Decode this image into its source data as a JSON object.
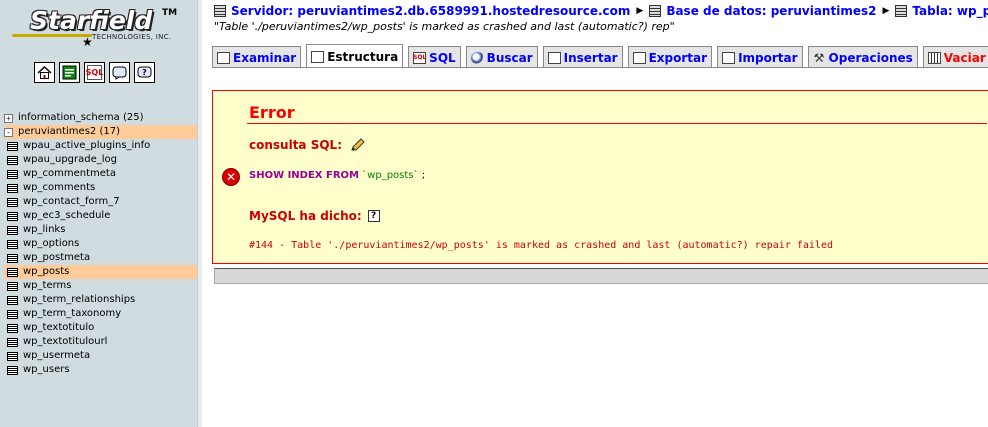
{
  "logo": {
    "brand": "Starfield",
    "tm": "TM",
    "sub": "TECHNOLOGIES, INC."
  },
  "nav_icons": [
    "home-icon",
    "sql-query-window-icon",
    "sql-icon",
    "docs-icon",
    "help-icon"
  ],
  "databases": [
    {
      "name": "information_schema (25)",
      "expander": "+",
      "active": false
    },
    {
      "name": "peruviantimes2 (17)",
      "expander": "-",
      "active": true
    }
  ],
  "tables": [
    "wpau_active_plugins_info",
    "wpau_upgrade_log",
    "wp_commentmeta",
    "wp_comments",
    "wp_contact_form_7",
    "wp_ec3_schedule",
    "wp_links",
    "wp_options",
    "wp_postmeta",
    "wp_posts",
    "wp_terms",
    "wp_term_relationships",
    "wp_term_taxonomy",
    "wp_textotitulo",
    "wp_textotitulourl",
    "wp_usermeta",
    "wp_users"
  ],
  "active_table": "wp_posts",
  "breadcrumb": {
    "server": "Servidor: peruviantimes2.db.6589991.hostedresource.com",
    "database": "Base de datos: peruviantimes2",
    "table": "Tabla: wp_posts"
  },
  "subtitle": "\"Table './peruviantimes2/wp_posts' is marked as crashed and last (automatic?) rep\"",
  "tabs": [
    {
      "label": "Examinar",
      "active": false,
      "danger": false
    },
    {
      "label": "Estructura",
      "active": true,
      "danger": false
    },
    {
      "label": "SQL",
      "active": false,
      "danger": false
    },
    {
      "label": "Buscar",
      "active": false,
      "danger": false
    },
    {
      "label": "Insertar",
      "active": false,
      "danger": false
    },
    {
      "label": "Exportar",
      "active": false,
      "danger": false
    },
    {
      "label": "Importar",
      "active": false,
      "danger": false
    },
    {
      "label": "Operaciones",
      "active": false,
      "danger": false
    },
    {
      "label": "Vaciar",
      "active": false,
      "danger": true
    }
  ],
  "error": {
    "title": "Error",
    "sql_label": "consulta SQL:",
    "query_keyword": "SHOW INDEX FROM",
    "query_table": "`wp_posts`",
    "query_end": ";",
    "mysql_label": "MySQL ha dicho:",
    "help_glyph": "?",
    "message": "#144 - Table './peruviantimes2/wp_posts' is marked as crashed and last (automatic?) repair failed"
  },
  "colors": {
    "nav_bg": "#d0dce0",
    "highlight": "#ffcc99",
    "link": "#0000ff",
    "error_bg": "#ffffcc",
    "error_red": "#ff0000"
  }
}
